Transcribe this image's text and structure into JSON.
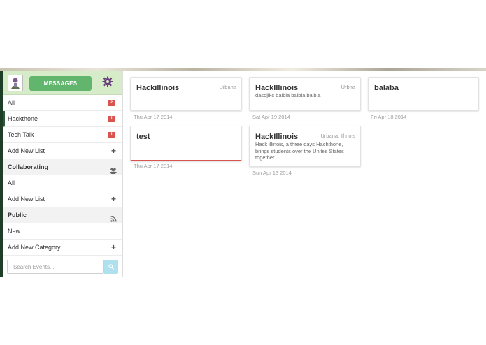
{
  "sidebar": {
    "messages_label": "MESSAGES",
    "lists": [
      {
        "label": "All",
        "badge": "2"
      },
      {
        "label": "Hackthone",
        "badge": "1"
      },
      {
        "label": "Tech Talk",
        "badge": "1"
      }
    ],
    "add_new_list_label": "Add New List",
    "collaborating": {
      "title": "Collaborating",
      "icon": "group-icon",
      "item": "All",
      "add_label": "Add New List"
    },
    "public": {
      "title": "Public",
      "icon": "rss-icon",
      "item": "New",
      "add_label": "Add New Category"
    },
    "search": {
      "placeholder": "Search Events..."
    }
  },
  "events": [
    {
      "title": "Hackillinois",
      "location": "Urbana",
      "description": "",
      "date": "Thu Apr 17 2014"
    },
    {
      "title": "HackIllinois",
      "location": "Urbna",
      "description": "dasdjlkc balbla balbia balbla",
      "date": "Sat Apr 19 2014"
    },
    {
      "title": "balaba",
      "location": "",
      "description": "",
      "date": "Fri Apr 18 2014"
    },
    {
      "title": "test",
      "location": "",
      "description": "",
      "date": "Thu Apr 17 2014"
    },
    {
      "title": "HackIllinois",
      "location": "Urbana, Illinois",
      "description": "Hack illinois, a three days Hachthone, brings students over the Unites States together.",
      "date": "Sun Apr 13 2014"
    }
  ],
  "colors": {
    "accent_green": "#62b56d",
    "badge_red": "#d9534f",
    "header_green": "#d6ebc8",
    "search_button": "#aee0ee"
  }
}
